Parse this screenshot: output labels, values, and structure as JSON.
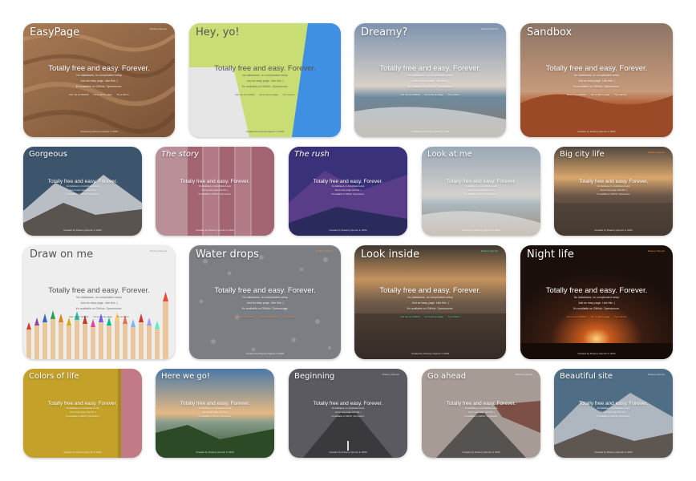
{
  "cards": [
    {
      "title": "EasyPage"
    },
    {
      "title": "Hey, yo!"
    },
    {
      "title": "Dreamy?"
    },
    {
      "title": "Sandbox"
    },
    {
      "title": "Gorgeous"
    },
    {
      "title": "The story"
    },
    {
      "title": "The rush"
    },
    {
      "title": "Look at me"
    },
    {
      "title": "Big city life"
    },
    {
      "title": "Draw on me"
    },
    {
      "title": "Water drops"
    },
    {
      "title": "Look inside"
    },
    {
      "title": "Night life"
    },
    {
      "title": "Colors of life"
    },
    {
      "title": "Here we go!"
    },
    {
      "title": "Beginning"
    },
    {
      "title": "Go ahead"
    },
    {
      "title": "Beautiful site"
    }
  ],
  "hero": {
    "headline": "Totally free and easy. Forever.",
    "line1": "No databases, no complicated setup",
    "line2": "Just an easy page. Like this :)",
    "line3": "It's available on GitHub. Opensource.",
    "link1": "Get me on GitHub",
    "link2": "Go to demo page",
    "link3": "Try a demo"
  },
  "nav_label": "Dreamy Opensr",
  "footer": "Created by Dreamy Opensr in 2022"
}
